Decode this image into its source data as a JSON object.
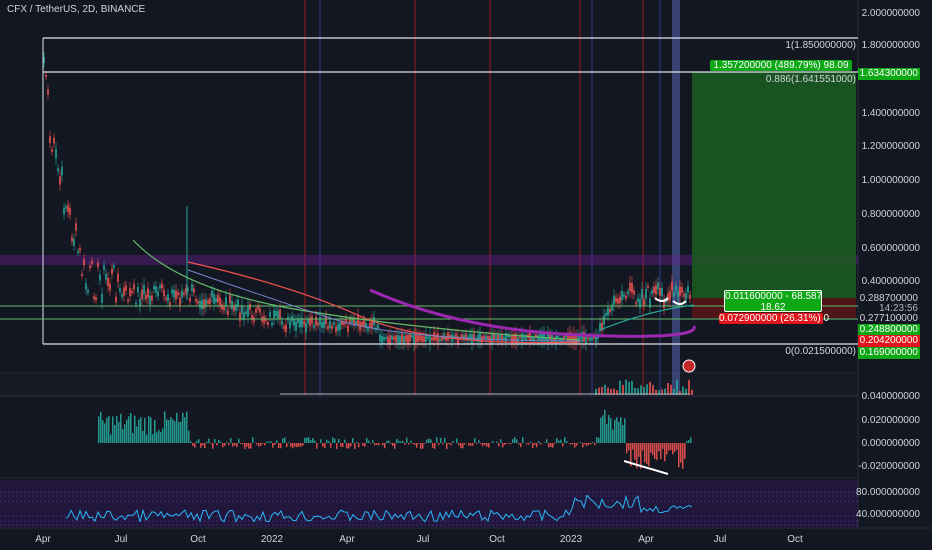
{
  "header": {
    "title": "CFX / TetherUS, 2D, BINANCE"
  },
  "price_axis": {
    "labels": [
      "2.000000000",
      "1.800000000",
      "1.400000000",
      "1.200000000",
      "1.000000000",
      "0.800000000",
      "0.600000000",
      "0.400000000"
    ],
    "tags": {
      "fib_top_tag": "1.634300000",
      "last_price": "0.288700000",
      "countdown": "14:23:56",
      "ma_a": "0.277100000",
      "ma_b": "0.248800000",
      "stop_tag": "0.204200000",
      "fib_bottom_tag": "0.169000000"
    }
  },
  "fib": {
    "top": "1(1.850000000)",
    "level_886": "0.886(1.641551000)",
    "bottom": "0(0.021500000)"
  },
  "position": {
    "target": "1.357200000 (489.79%) 98.09",
    "entry_line1": "0.011600000 - 68.587",
    "entry_line2": "18.62",
    "stop": "0.072900000 (26.31%) 0"
  },
  "oscillator_axis": {
    "labels": [
      "0.040000000",
      "0.020000000",
      "0.000000000",
      "-0.020000000"
    ]
  },
  "rsi_axis": {
    "labels": [
      "80.000000000",
      "40.000000000"
    ]
  },
  "time_axis": {
    "labels": [
      "Apr",
      "Jul",
      "Oct",
      "2022",
      "Apr",
      "Jul",
      "Oct",
      "2023",
      "Apr",
      "Jul",
      "Oct"
    ]
  },
  "colors": {
    "background": "#131722",
    "up": "#26a69a",
    "down": "#ef5350",
    "target_zone": "#1b5e20",
    "entry": "#0ea816",
    "stop": "#e0151e",
    "ma_purple": "#9c27b0",
    "rsi_line": "#29b6f6"
  }
}
